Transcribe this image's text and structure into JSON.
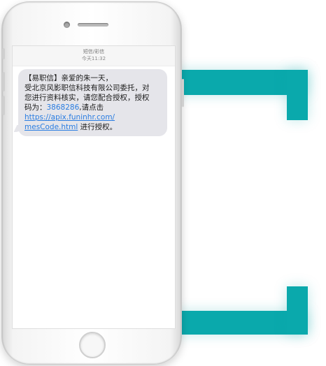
{
  "header": {
    "sender": "短信/彩信",
    "timestamp": "今天11:32"
  },
  "message": {
    "line1": "【易职信】亲爱的朱一天，",
    "line2": "受北京风影职信科技有限公司委托，对",
    "line3": "您进行资料核实，请您配合授权，授权",
    "line4_prefix": "码为：",
    "auth_code": "3868286",
    "line4_suffix": ",请点击",
    "url_part1": "https://apix.funinhr.com/",
    "url_part2": "mesCode.html",
    "line6_suffix": " 进行授权。"
  },
  "colors": {
    "accent_teal": "#0aa9ac",
    "link_blue": "#2a7de1",
    "bubble_gray": "#e5e5ea"
  }
}
